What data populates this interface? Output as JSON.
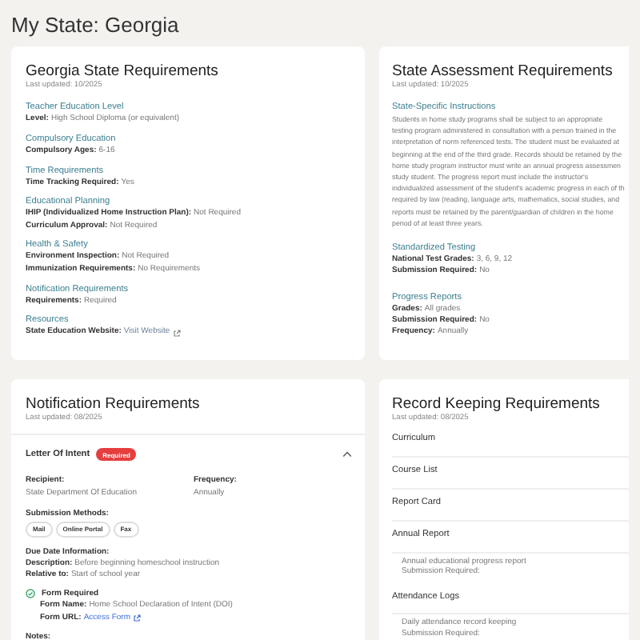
{
  "page_title": "My State: Georgia",
  "state_requirements": {
    "title": "Georgia State Requirements",
    "updated": "Last updated: 10/2025",
    "sections": [
      {
        "heading": "Teacher Education Level",
        "fields": [
          {
            "label": "Level:",
            "value": "High School Diploma (or equivalent)",
            "kind": "text"
          }
        ]
      },
      {
        "heading": "Compulsory Education",
        "fields": [
          {
            "label": "Compulsory Ages:",
            "value": "6-16",
            "kind": "text"
          }
        ]
      },
      {
        "heading": "Time Requirements",
        "fields": [
          {
            "label": "Time Tracking Required:",
            "value": "Yes",
            "kind": "text"
          }
        ]
      },
      {
        "heading": "Educational Planning",
        "fields": [
          {
            "label": "IHIP (Individualized Home Instruction Plan):",
            "value": "Not Required",
            "kind": "text"
          },
          {
            "label": "Curriculum Approval:",
            "value": "Not Required",
            "kind": "text"
          }
        ]
      },
      {
        "heading": "Health & Safety",
        "fields": [
          {
            "label": "Environment Inspection:",
            "value": "Not Required",
            "kind": "text"
          },
          {
            "label": "Immunization Requirements:",
            "value": "No Requirements",
            "kind": "text"
          }
        ]
      },
      {
        "heading": "Notification Requirements",
        "fields": [
          {
            "label": "Requirements:",
            "value": "Required",
            "kind": "text"
          }
        ]
      },
      {
        "heading": "Resources",
        "fields": [
          {
            "label": "State Education Website:",
            "value": "Visit Website",
            "kind": "link"
          }
        ]
      }
    ]
  },
  "assessment": {
    "title": "State Assessment Requirements",
    "updated": "Last updated: 10/2025",
    "instructions_heading": "State-Specific Instructions",
    "instruction_lines": [
      "Students in home study programs shall be subject to an appropriate",
      "testing program administered in consultation with a person trained in the",
      "interpretation of norm referenced tests. The student must be evaluated at",
      "beginning at the end of the third grade. Records should be retained by the",
      "home study program instructor must write an annual progress assessmen",
      "study student. The progress report must include the instructor's",
      "individualized assessment of the student's academic progress in each of th",
      "required by law (reading, language arts, mathematics, social studies, and",
      "reports must be retained by the parent/guardian of children in the home",
      "period of at least three years."
    ],
    "sections": [
      {
        "heading": "Standardized Testing",
        "fields": [
          {
            "label": "National Test Grades:",
            "value": "3, 6, 9, 12"
          },
          {
            "label": "Submission Required:",
            "value": "No"
          }
        ]
      },
      {
        "heading": "Progress Reports",
        "fields": [
          {
            "label": "Grades:",
            "value": "All grades"
          },
          {
            "label": "Submission Required:",
            "value": "No"
          },
          {
            "label": "Frequency:",
            "value": "Annually"
          }
        ]
      }
    ]
  },
  "notification": {
    "title": "Notification Requirements",
    "updated": "Last updated: 08/2025",
    "item": {
      "title": "Letter Of Intent",
      "badge": "Required",
      "expanded": true,
      "recipient_label": "Recipient:",
      "recipient": "State Department Of Education",
      "frequency_label": "Frequency:",
      "frequency": "Annually",
      "methods_label": "Submission Methods:",
      "methods": [
        "Mail",
        "Online Portal",
        "Fax"
      ],
      "due_label": "Due Date Information:",
      "due_fields": [
        {
          "label": "Description:",
          "value": "Before beginning homeschool instruction"
        },
        {
          "label": "Relative to:",
          "value": "Start of school year"
        }
      ],
      "form_required": true,
      "form_label": "Form Required",
      "form_name_label": "Form Name:",
      "form_name": "Home School Declaration of Intent (DOI)",
      "form_url_label": "Form URL:",
      "form_url": "Access Form",
      "notes_label": "Notes:"
    }
  },
  "record_keeping": {
    "title": "Record Keeping Requirements",
    "updated": "Last updated: 08/2025",
    "items": [
      {
        "title": "Curriculum"
      },
      {
        "title": "Course List"
      },
      {
        "title": "Report Card"
      },
      {
        "title": "Annual Report",
        "details": [
          "Annual educational progress report",
          "Submission Required:"
        ]
      },
      {
        "title": "Attendance Logs",
        "details": [
          "Daily attendance record keeping",
          "Submission Required:"
        ]
      }
    ]
  }
}
